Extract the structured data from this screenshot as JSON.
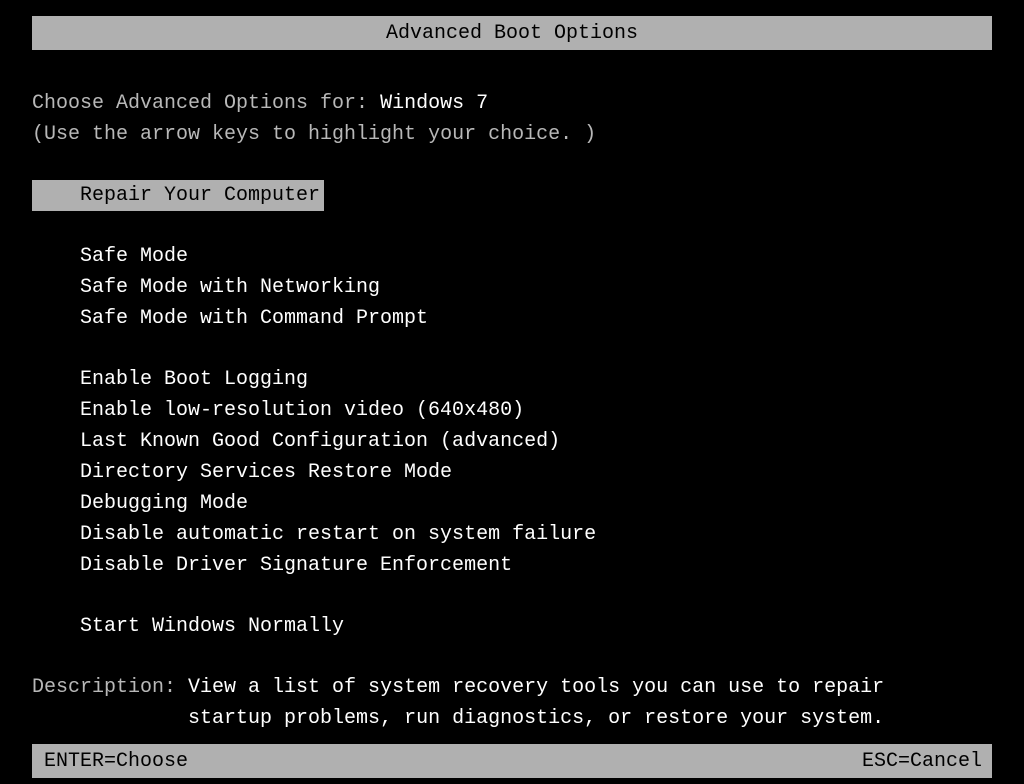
{
  "title": "Advanced Boot Options",
  "prompt_prefix": "Choose Advanced Options for: ",
  "os_name": "Windows 7",
  "hint": "(Use the arrow keys to highlight your choice. )",
  "menu": {
    "selected_index": 0,
    "groups": [
      [
        "Repair Your Computer"
      ],
      [
        "Safe Mode",
        "Safe Mode with Networking",
        "Safe Mode with Command Prompt"
      ],
      [
        "Enable Boot Logging",
        "Enable low-resolution video (640x480)",
        "Last Known Good Configuration (advanced)",
        "Directory Services Restore Mode",
        "Debugging Mode",
        "Disable automatic restart on system failure",
        "Disable Driver Signature Enforcement"
      ],
      [
        "Start Windows Normally"
      ]
    ]
  },
  "description": {
    "label": "Description: ",
    "line1": "View a list of system recovery tools you can use to repair",
    "line2_indent": "             ",
    "line2": "startup problems, run diagnostics, or restore your system."
  },
  "footer": {
    "enter": "ENTER=Choose",
    "esc": "ESC=Cancel"
  }
}
